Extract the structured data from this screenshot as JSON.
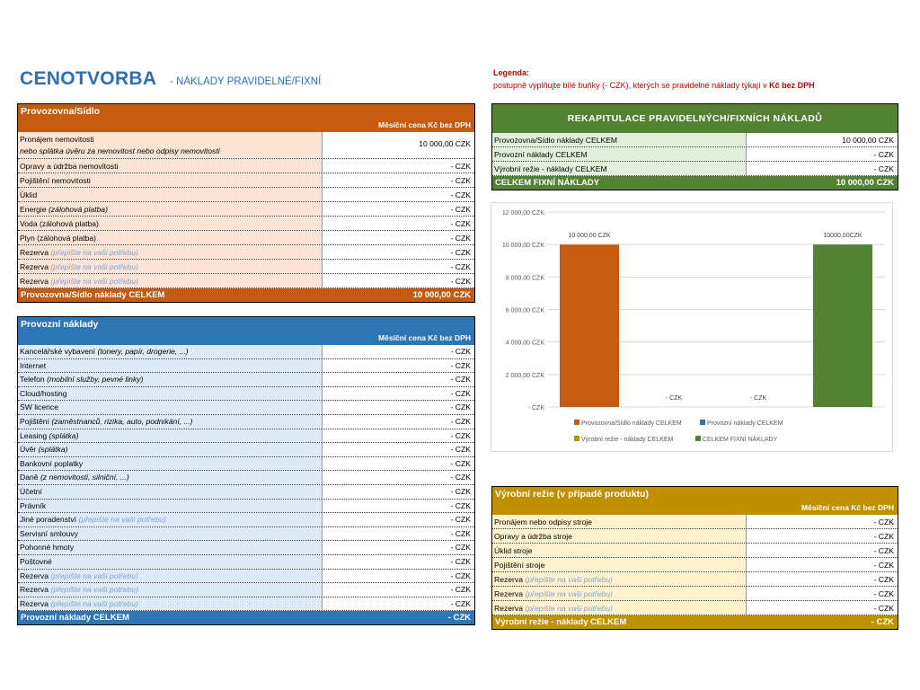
{
  "page": {
    "title": "CENOTVORBA",
    "subtitle": "- NÁKLADY PRAVIDELNÉ/FIXNÍ",
    "legend_title": "Legenda:",
    "legend_text": "postupně vyplňujte bílé buňky (- CZK), kterých se pravidelné náklady týkají v",
    "legend_bold": "Kč bez DPH"
  },
  "provozovna": {
    "header": "Provozovna/Sídlo",
    "subheader": "Měsíční cena Kč bez DPH",
    "rows": [
      {
        "label": "Pronájem nemovitosti",
        "note": "nebo splátka úvěru za nemovitost nebo odpisy nemovitosti",
        "value": "10 000,00 CZK"
      },
      {
        "label": "Opravy a údržba nemovitosti",
        "note": "",
        "value": "-   CZK"
      },
      {
        "label": "Pojištění nemovitosti",
        "note": "",
        "value": "-   CZK"
      },
      {
        "label": "Úklid",
        "note": "",
        "value": "-   CZK"
      },
      {
        "label": "Energie",
        "note": "(zálohová platba)",
        "value": "-   CZK"
      },
      {
        "label": "Voda (zálohová platba)",
        "note": "",
        "value": "-   CZK"
      },
      {
        "label": "Plyn (zálohová platba)",
        "note": "",
        "value": "-   CZK"
      },
      {
        "label": "Rezerva",
        "hint": "(přepište na vaši potřebu)",
        "value": "-   CZK"
      },
      {
        "label": "Rezerva",
        "hint": "(přepište na vaši potřebu)",
        "value": "-   CZK"
      },
      {
        "label": "Rezerva",
        "hint": "(přepište na vaši potřebu)",
        "value": "-   CZK"
      }
    ],
    "total_label": "Provozovna/Sídlo náklady CELKEM",
    "total_value": "10 000,00 CZK"
  },
  "provozni": {
    "header": "Provozní náklady",
    "subheader": "Měsíční cena Kč bez DPH",
    "rows": [
      {
        "label": "Kancelářské vybavení",
        "note": "(tonery, papír, drogerie, ...)",
        "value": "-   CZK"
      },
      {
        "label": "Internet",
        "note": "",
        "value": "-   CZK"
      },
      {
        "label": "Telefon",
        "note": "(mobilní služby, pevné linky)",
        "value": "-   CZK"
      },
      {
        "label": "Cloud/hosting",
        "note": "",
        "value": "-   CZK"
      },
      {
        "label": "SW licence",
        "note": "",
        "value": "-   CZK"
      },
      {
        "label": "Pojištění",
        "note": "(zaměstnanců, rizika, auto, podnikání, ...)",
        "value": "-   CZK"
      },
      {
        "label": "Leasing",
        "note": "(splátka)",
        "value": "-   CZK"
      },
      {
        "label": "Úvěr",
        "note": "(splátka)",
        "value": "-   CZK"
      },
      {
        "label": "Bankovní poplatky",
        "note": "",
        "value": "-   CZK"
      },
      {
        "label": "Daně",
        "note": "(z nemovitosti, silniční, ...)",
        "value": "-   CZK"
      },
      {
        "label": "Účetní",
        "note": "",
        "value": "-   CZK"
      },
      {
        "label": "Právník",
        "note": "",
        "value": "-   CZK"
      },
      {
        "label": "Jiné poradenství",
        "hint": "(přepište na vaši potřebu)",
        "value": "-   CZK"
      },
      {
        "label": "Servisní smlouvy",
        "note": "",
        "value": "-   CZK"
      },
      {
        "label": "Pohonné hmoty",
        "note": "",
        "value": "-   CZK"
      },
      {
        "label": "Poštovné",
        "note": "",
        "value": "-   CZK"
      },
      {
        "label": "Rezerva",
        "hint": "(přepište na vaši potřebu)",
        "value": "-   CZK"
      },
      {
        "label": "Rezerva",
        "hint": "(přepište na vaši potřebu)",
        "value": "-   CZK"
      },
      {
        "label": "Rezerva",
        "hint": "(přepište na vaši potřebu)",
        "value": "-   CZK"
      }
    ],
    "total_label": "Provozní náklady CELKEM",
    "total_value": "-   CZK"
  },
  "rekapitulace": {
    "header": "REKAPITULACE PRAVIDELNÝCH/FIXNÍCH NÁKLADŮ",
    "rows": [
      {
        "label": "Provozovna/Sídlo náklady CELKEM",
        "value": "10 000,00 CZK"
      },
      {
        "label": "Provozní náklady CELKEM",
        "value": "-   CZK"
      },
      {
        "label": "Výrobní režie - náklady CELKEM",
        "value": "-   CZK"
      }
    ],
    "total_label": "CELKEM FIXNÍ NÁKLADY",
    "total_value": "10 000,00 CZK"
  },
  "vyrobni": {
    "header": "Výrobní režie (v případě produktu)",
    "subheader": "Měsíční cena Kč bez DPH",
    "rows": [
      {
        "label": "Pronájem nebo odpisy stroje",
        "value": "-   CZK"
      },
      {
        "label": "Opravy a údržba stroje",
        "value": "-   CZK"
      },
      {
        "label": "Úklid stroje",
        "value": "-   CZK"
      },
      {
        "label": "Pojištění stroje",
        "value": "-   CZK"
      },
      {
        "label": "Rezerva",
        "hint": "(přepište na vaši potřebu)",
        "value": "-   CZK"
      },
      {
        "label": "Rezerva",
        "hint": "(přepište na vaši potřebu)",
        "value": "-   CZK"
      },
      {
        "label": "Rezerva",
        "hint": "(přepište na vaši potřebu)",
        "value": "-   CZK"
      }
    ],
    "total_label": "Výrobní režie - náklady CELKEM",
    "total_value": "-   CZK"
  },
  "chart_data": {
    "type": "bar",
    "categories": [
      "Provozovna/Sídlo náklady CELKEM",
      "Provozní náklady CELKEM",
      "Výrobní režie - náklady CELKEM",
      "CELKEM FIXNÍ NÁKLADY"
    ],
    "values": [
      10000,
      0,
      0,
      10000
    ],
    "data_labels": [
      "10 000,00 CZK",
      "-   CZK",
      "-   CZK",
      "10000,00CZK"
    ],
    "colors": [
      "#c55a11",
      "#2e75b6",
      "#bf9000",
      "#548235"
    ],
    "yticks": [
      "-   CZK",
      "2 000,00 CZK",
      "4 000,00 CZK",
      "6 000,00 CZK",
      "8 000,00 CZK",
      "10 000,00 CZK",
      "12 000,00 CZK"
    ],
    "ylim": [
      0,
      12000
    ],
    "legend_position": "bottom",
    "grid": true
  }
}
